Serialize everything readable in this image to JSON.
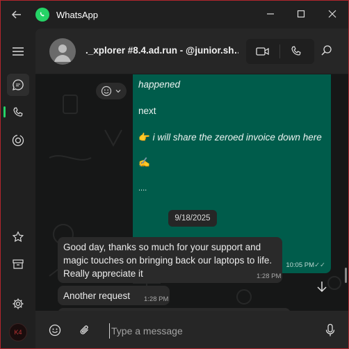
{
  "app": {
    "title": "WhatsApp"
  },
  "window_controls": {
    "minimize": "minimize-icon",
    "maximize": "maximize-icon",
    "close": "close-icon"
  },
  "sidebar": {
    "items": [
      {
        "name": "menu",
        "icon": "hamburger-icon"
      },
      {
        "name": "chats",
        "icon": "chat-icon",
        "active": true
      },
      {
        "name": "calls",
        "icon": "phone-icon"
      },
      {
        "name": "status",
        "icon": "status-icon"
      },
      {
        "name": "starred",
        "icon": "star-icon"
      },
      {
        "name": "archived",
        "icon": "archive-icon"
      },
      {
        "name": "settings",
        "icon": "gear-icon"
      }
    ],
    "profile_initials": "K4"
  },
  "header": {
    "contact_name": "._xplorer #8.4.ad.run - @junior.sh…",
    "video_icon": "video-icon",
    "call_icon": "phone-icon",
    "search_icon": "search-icon"
  },
  "messages": {
    "outgoing": {
      "partial_text": "happened",
      "line_next": "next",
      "line_invoice_emoji": "👉",
      "line_invoice": "i will share the zeroed invoice down here",
      "line_sign": "✍️",
      "line_dots": "....",
      "time": "10:05 PM",
      "status": "✓✓"
    },
    "date_separator": "9/18/2025",
    "incoming": [
      {
        "text_1": "Good day, thanks so much for your support and",
        "text_2": "magic touches on bringing back our laptops to life.",
        "text_3": "Really appreciate it",
        "time": "1:28 PM"
      },
      {
        "text_1": "Another request",
        "time": "1:28 PM"
      }
    ]
  },
  "composer": {
    "placeholder": "Type a message",
    "emoji_icon": "emoji-icon",
    "attach_icon": "paperclip-icon",
    "mic_icon": "mic-icon"
  },
  "colors": {
    "accent": "#25d366",
    "outgoing_bubble": "#005c4b",
    "incoming_bubble": "#2a2a2a",
    "window_border": "#b3262d"
  }
}
